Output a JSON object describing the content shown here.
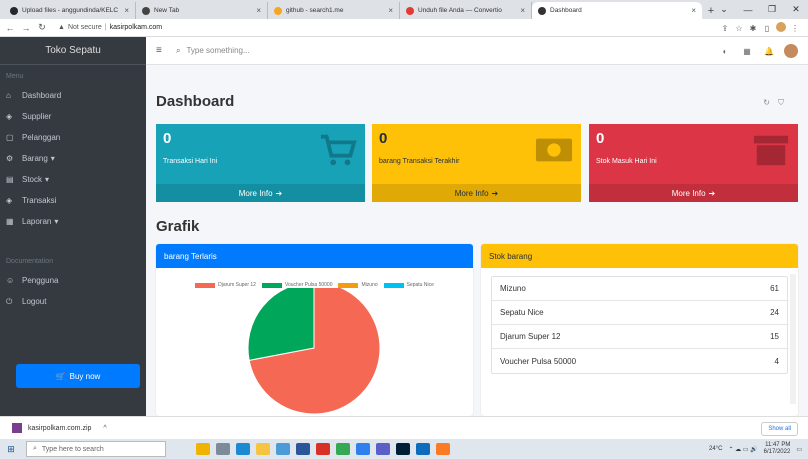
{
  "browser": {
    "tabs": [
      {
        "title": "Upload files - anggundinda/KELC",
        "close": "×",
        "fav_color": "#24292e",
        "active": false
      },
      {
        "title": "New Tab",
        "close": "×",
        "fav_color": "#444444",
        "active": false
      },
      {
        "title": "github - search1.me",
        "close": "×",
        "fav_color": "#f5a623",
        "active": false
      },
      {
        "title": "Unduh file Anda — Convertio",
        "close": "×",
        "fav_color": "#e53935",
        "active": false
      },
      {
        "title": "Dashboard",
        "close": "×",
        "fav_color": "#333333",
        "active": true
      }
    ],
    "new_tab": "+",
    "address": {
      "not_secure": "Not secure",
      "separator": "|",
      "host": "kasirpolkam.com"
    }
  },
  "sidebar": {
    "brand": "Toko Sepatu",
    "section_menu": "Menu",
    "items": [
      {
        "label": "Dashboard",
        "icon": "home-icon"
      },
      {
        "label": "Supplier",
        "icon": "layers-icon"
      },
      {
        "label": "Pelanggan",
        "icon": "clipboard-icon"
      },
      {
        "label": "Barang",
        "icon": "gear-icon",
        "caret": "▾"
      },
      {
        "label": "Stock",
        "icon": "calendar-icon",
        "caret": "▾"
      },
      {
        "label": "Transaksi",
        "icon": "layers-icon"
      },
      {
        "label": "Laporan",
        "icon": "grid-icon",
        "caret": "▾"
      }
    ],
    "section_doc": "Documentation",
    "items2": [
      {
        "label": "Pengguna",
        "icon": "users-icon"
      },
      {
        "label": "Logout",
        "icon": "power-icon"
      }
    ],
    "buy": "Buy now"
  },
  "topbar": {
    "search_placeholder": "Type something..."
  },
  "page": {
    "title": "Dashboard",
    "grafik": "Grafik"
  },
  "boxes": [
    {
      "value": "0",
      "label": "Transaksi Hari Ini",
      "more": "More Info",
      "color": "#17a2b8"
    },
    {
      "value": "0",
      "label": "barang Transaksi Terakhir",
      "more": "More Info",
      "color": "#ffc107"
    },
    {
      "value": "0",
      "label": "Stok Masuk Hari Ini",
      "more": "More Info",
      "color": "#dc3545"
    }
  ],
  "chart_card": {
    "title": "barang Terlaris",
    "header_color": "#007bff"
  },
  "chart_data": {
    "type": "pie",
    "labels": [
      "Djarum Super 12",
      "Voucher Pulsa 50000",
      "Mizuno",
      "Sepatu Nice"
    ],
    "values": [
      72,
      28,
      0,
      0
    ],
    "colors": [
      "#f56954",
      "#00a65a",
      "#f39c12",
      "#00c0ef"
    ],
    "legend": "top"
  },
  "stock_card": {
    "title": "Stok barang",
    "header_color": "#ffc107",
    "rows": [
      {
        "name": "Mizuno",
        "qty": "61"
      },
      {
        "name": "Sepatu Nice",
        "qty": "24"
      },
      {
        "name": "Djarum Super 12",
        "qty": "15"
      },
      {
        "name": "Voucher Pulsa 50000",
        "qty": "4"
      }
    ]
  },
  "downloads": {
    "file": "kasirpolkam.com.zip",
    "show_all": "Show all"
  },
  "taskbar": {
    "search": "Type here to search",
    "temp": "24°C",
    "time": "11:47 PM",
    "date": "6/17/2022"
  }
}
